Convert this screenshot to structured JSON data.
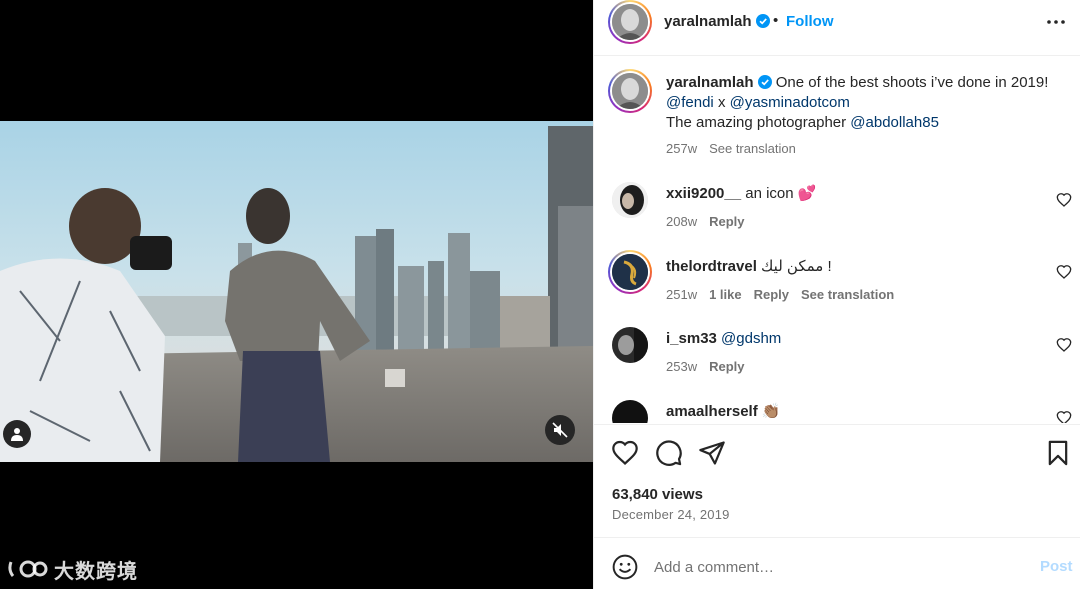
{
  "post": {
    "username": "yaralnamlah",
    "follow_label": "Follow",
    "separator": "•",
    "caption": {
      "username": "yaralnamlah",
      "text": "One of the best shoots i’ve done in 2019!",
      "mention1": "@fendi",
      "x_text": "x",
      "mention2": "@yasminadotcom",
      "line3_text": "The amazing photographer",
      "mention3": "@abdollah85",
      "time": "257w",
      "see_translation": "See translation"
    },
    "comments": [
      {
        "username": "xxii9200__",
        "text": "an icon 💕",
        "time": "208w",
        "reply": "Reply"
      },
      {
        "username": "thelordtravel",
        "text": "ممكن ليك !",
        "time": "251w",
        "likes": "1 like",
        "reply": "Reply",
        "see_translation": "See translation"
      },
      {
        "username": "i_sm33",
        "mention": "@gdshm",
        "time": "253w",
        "reply": "Reply"
      },
      {
        "username": "amaalherself",
        "text": "👏🏽"
      }
    ],
    "views": "63,840 views",
    "date": "December 24, 2019",
    "comment_placeholder": "Add a comment…",
    "post_label": "Post"
  },
  "watermark": {
    "text": "大数跨境"
  },
  "colors": {
    "accent": "#0095f6",
    "mention": "#00376b",
    "muted": "#737373",
    "post_disabled": "#b3dbff"
  },
  "icons": {
    "verified": "verified-badge-icon",
    "more": "more-options-icon",
    "like": "heart-icon",
    "comment": "comment-icon",
    "share": "share-icon",
    "save": "bookmark-icon",
    "emoji": "emoji-icon",
    "mute": "muted-speaker-icon",
    "user_tag": "user-tag-icon"
  }
}
